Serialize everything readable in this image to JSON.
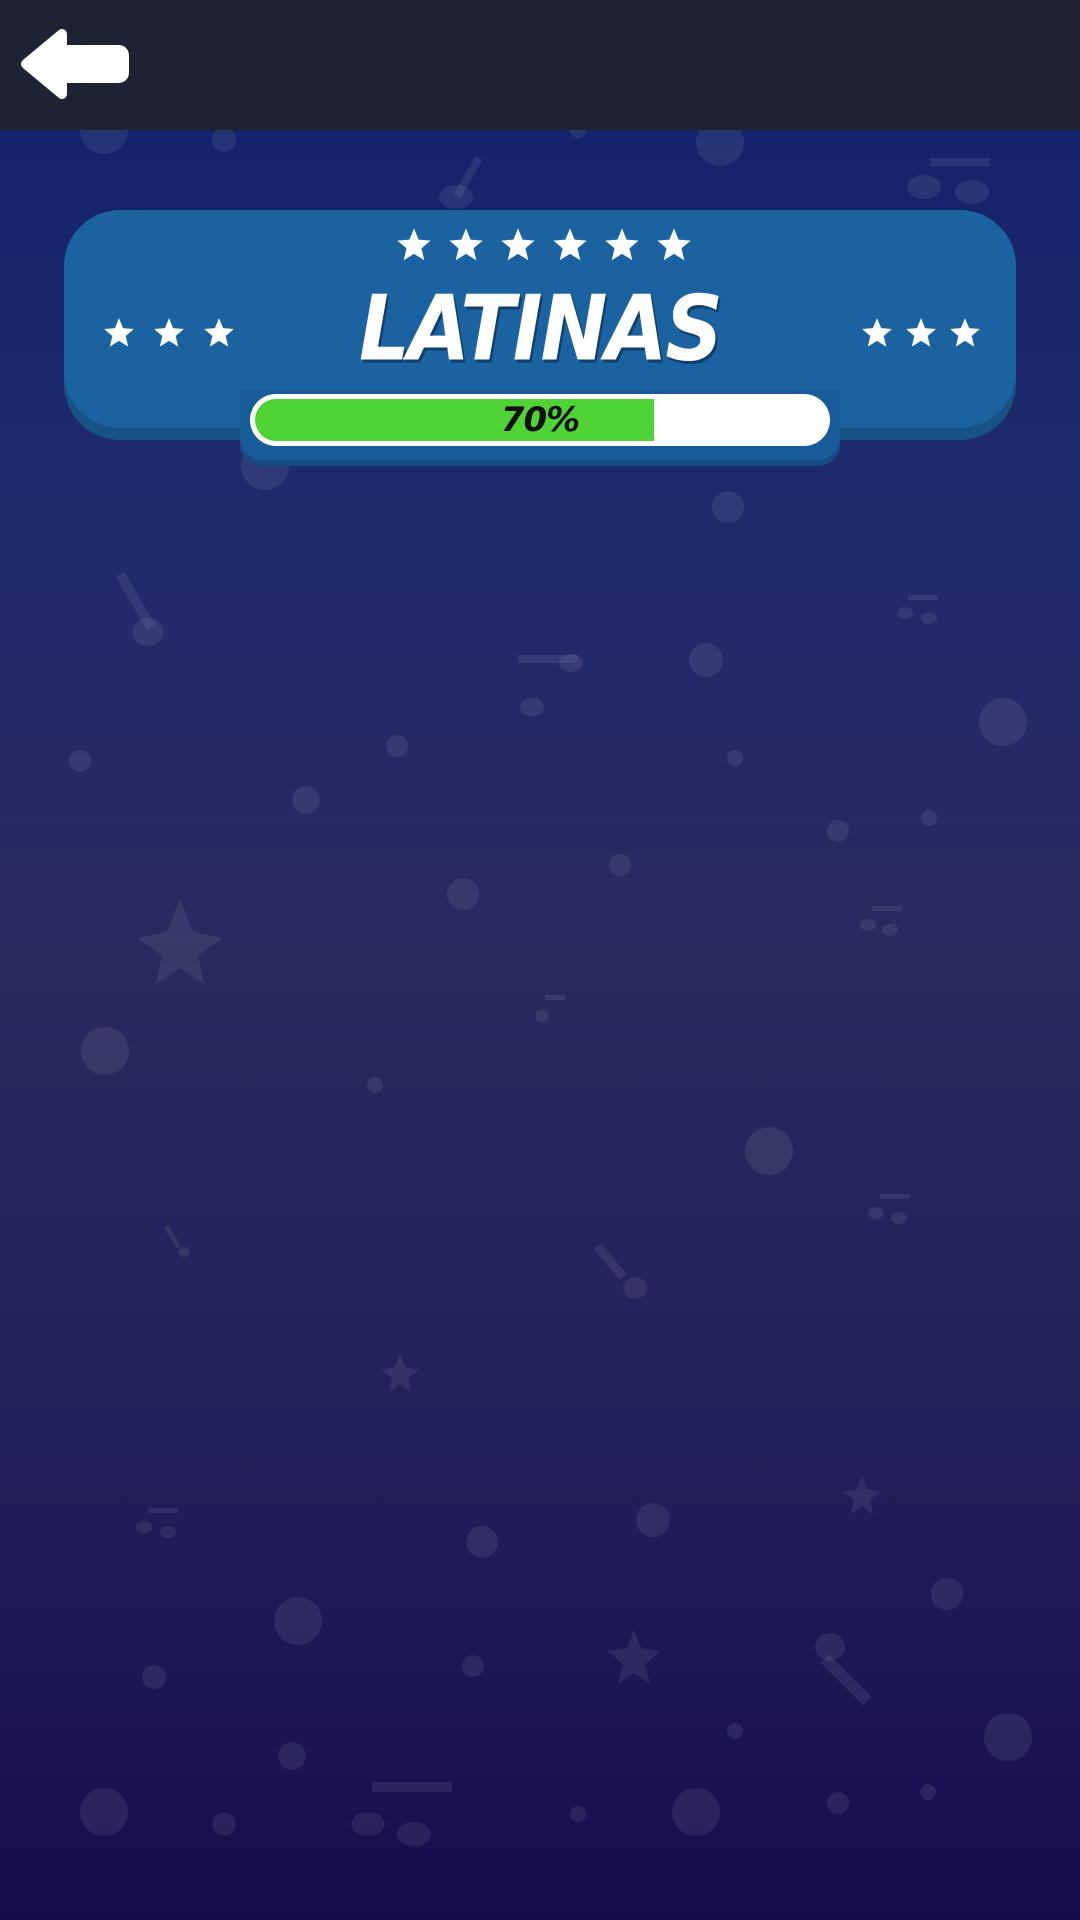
{
  "header": {
    "back_icon": "arrow-left-icon"
  },
  "card": {
    "title": "LATINAS",
    "top_stars": 6,
    "left_stars": 3,
    "right_stars": 3,
    "star_icon": "star-icon",
    "bg_color": "#1a63a0"
  },
  "progress": {
    "label": "70%",
    "value": 0.7,
    "fill_color": "#4ed535",
    "track_color": "#ffffff"
  },
  "theme": {
    "topbar_color": "#1f2233",
    "bg_top": "#10206a",
    "bg_bottom": "#170d4c"
  }
}
